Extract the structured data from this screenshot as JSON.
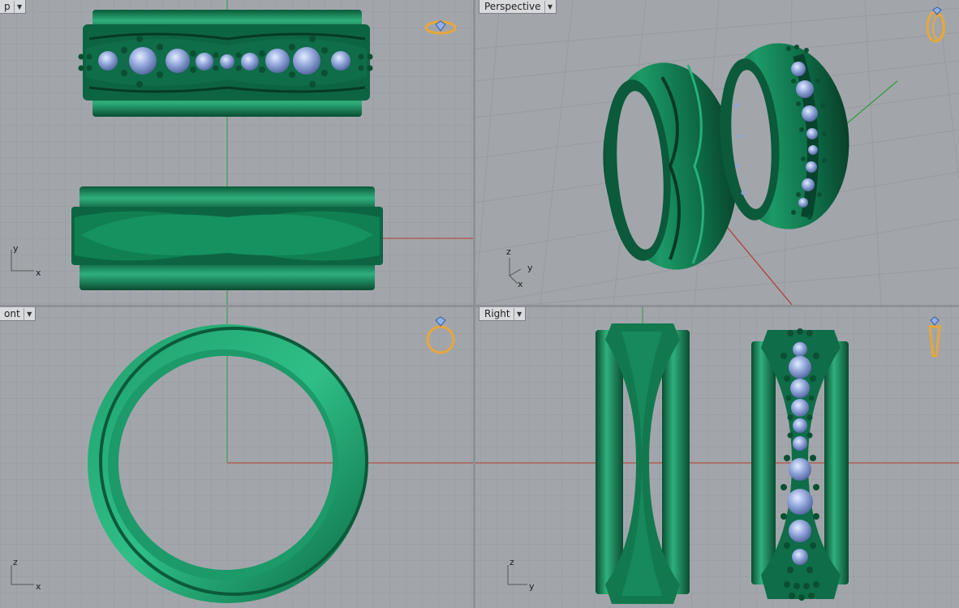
{
  "viewports": {
    "top": {
      "label": "p",
      "axis1": "y",
      "axis2": "x"
    },
    "perspective": {
      "label": "Perspective",
      "axis1": "z",
      "axis2": "y",
      "axis3": "x"
    },
    "front": {
      "label": "ont",
      "axis1": "z",
      "axis2": "x"
    },
    "right": {
      "label": "Right",
      "axis1": "z",
      "axis2": "y"
    }
  },
  "colors": {
    "viewport_bg": "#a2a6ab",
    "grid_minor": "#979ba0",
    "grid_major": "#8a8e93",
    "axis_x": "#b03a2e",
    "axis_y": "#2f9a3a",
    "metal": "#137a52",
    "gem": "#8fa4d8",
    "gizmo": "#e8a73a"
  },
  "icons": {
    "view_dropdown": "chevron-down-icon",
    "gizmo": "ring-gizmo-icon"
  }
}
